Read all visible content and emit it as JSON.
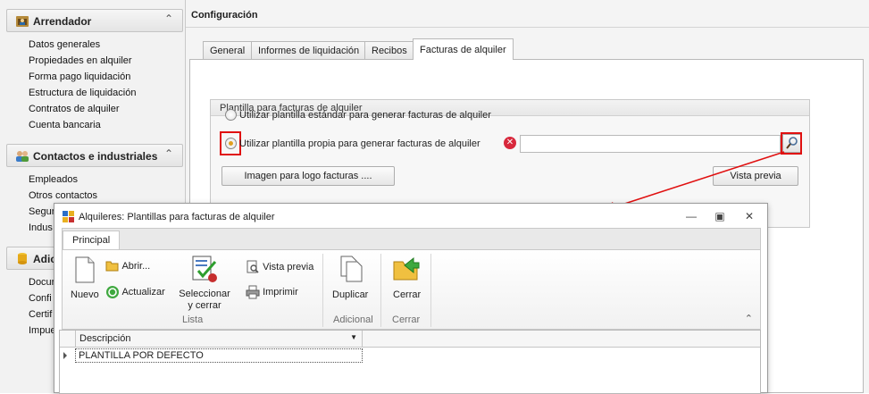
{
  "nav": {
    "groups": [
      {
        "title": "Arrendador",
        "icon": "landlord-icon",
        "items": [
          "Datos generales",
          "Propiedades en alquiler",
          "Forma pago liquidación",
          "Estructura de liquidación",
          "Contratos de alquiler",
          "Cuenta bancaria"
        ]
      },
      {
        "title": "Contactos e industriales",
        "icon": "contacts-icon",
        "items": [
          "Empleados",
          "Otros contactos",
          "Segur",
          "Indus"
        ]
      },
      {
        "title": "Adic",
        "icon": "database-icon",
        "items": [
          "Docur",
          "Confi",
          "Certif",
          "Impue"
        ]
      }
    ]
  },
  "main": {
    "title": "Configuración",
    "tabs": [
      "General",
      "Informes de liquidación",
      "Recibos",
      "Facturas de alquiler"
    ],
    "active_tab": "Facturas de alquiler",
    "group_title": "Plantilla para facturas de alquiler",
    "radio_standard": "Utilizar plantilla estándar para generar facturas de alquiler",
    "radio_own": "Utilizar plantilla propia para generar facturas de alquiler",
    "template_value": "",
    "logo_button": "Imagen para logo facturas ....",
    "preview_button": "Vista previa"
  },
  "dialog": {
    "title": "Alquileres: Plantillas para facturas de alquiler",
    "ribbon_tab": "Principal",
    "groups": {
      "lista": "Lista",
      "adicional": "Adicional",
      "cerrar": "Cerrar"
    },
    "buttons": {
      "nuevo": "Nuevo",
      "abrir": "Abrir...",
      "actualizar": "Actualizar",
      "seleccionar": "Seleccionar",
      "seleccionar2": "y cerrar",
      "vista_previa": "Vista previa",
      "imprimir": "Imprimir",
      "duplicar": "Duplicar",
      "cerrar": "Cerrar"
    },
    "grid": {
      "column": "Descripción",
      "rows": [
        "PLANTILLA POR DEFECTO"
      ]
    }
  },
  "colors": {
    "highlight_red": "#e01010",
    "radio_selected": "#e0a020",
    "error_icon": "#d8283c"
  }
}
